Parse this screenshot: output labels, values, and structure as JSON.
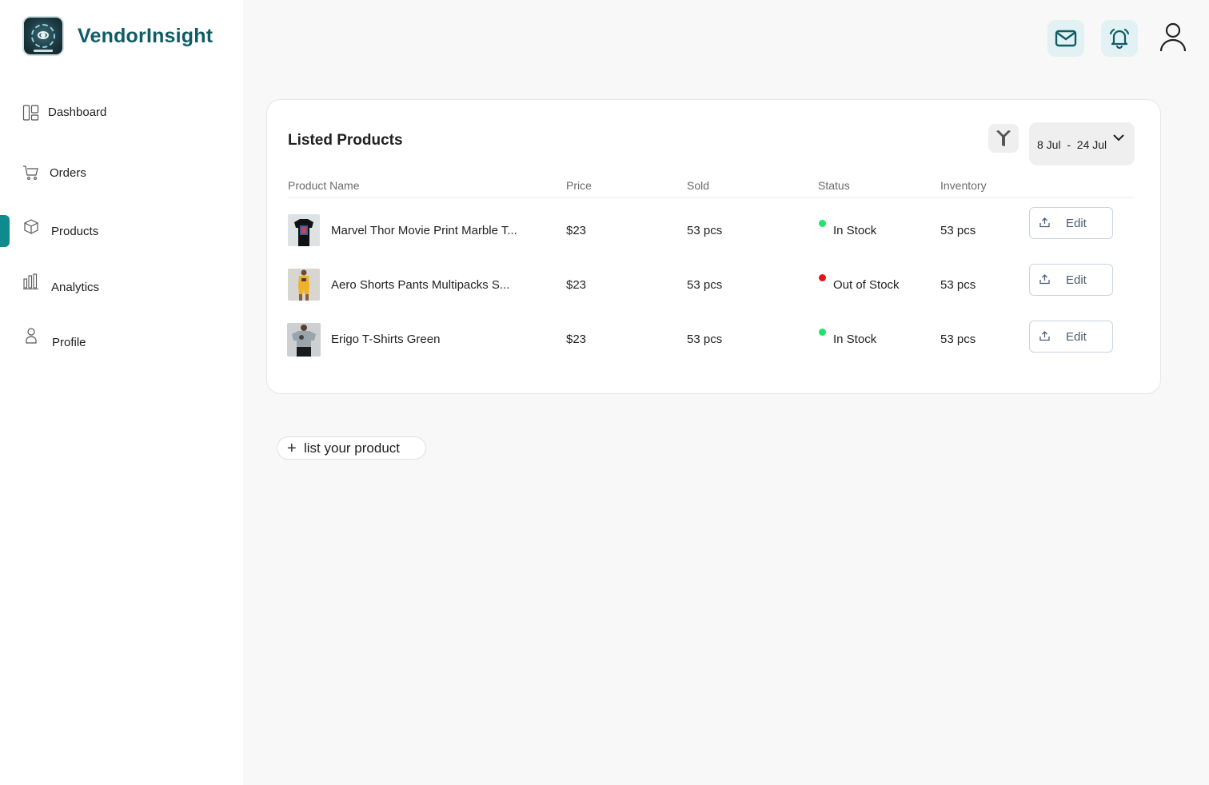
{
  "brand": {
    "name": "VendorInsight",
    "logo_icon": "vendorinsight-logo"
  },
  "sidebar": {
    "active": "Products",
    "accent_color": "#0f8a8f",
    "items": [
      {
        "label": "Dashboard",
        "icon": "dashboard-icon"
      },
      {
        "label": "Orders",
        "icon": "cart-icon"
      },
      {
        "label": "Products",
        "icon": "box-icon"
      },
      {
        "label": "Analytics",
        "icon": "bar-chart-icon"
      },
      {
        "label": "Profile",
        "icon": "person-icon"
      }
    ]
  },
  "header": {
    "icons": [
      "mail-icon",
      "bell-icon",
      "user-icon"
    ],
    "icon_bg": "#e2f1f3",
    "icon_color": "#0f5c66"
  },
  "card": {
    "title": "Listed Products",
    "date_range": "8 Jul  -  24 Jul",
    "filter_icon": "filter-icon",
    "columns": [
      "Product Name",
      "Price",
      "Sold",
      "Status",
      "Inventory"
    ],
    "rows": [
      {
        "name": "Marvel Thor Movie Print Marble T...",
        "price": "$23",
        "sold": "53 pcs",
        "status": "In Stock",
        "status_color": "#1ee36e",
        "inventory": "53 pcs",
        "action": "Edit"
      },
      {
        "name": "Aero Shorts Pants Multipacks S...",
        "price": "$23",
        "sold": "53 pcs",
        "status": "Out of Stock",
        "status_color": "#e8131b",
        "inventory": "53 pcs",
        "action": "Edit"
      },
      {
        "name": "Erigo T-Shirts Green",
        "price": "$23",
        "sold": "53 pcs",
        "status": "In Stock",
        "status_color": "#1ee36e",
        "inventory": "53 pcs",
        "action": "Edit"
      }
    ]
  },
  "list_product": {
    "label": "list your product",
    "icon": "plus-icon"
  }
}
